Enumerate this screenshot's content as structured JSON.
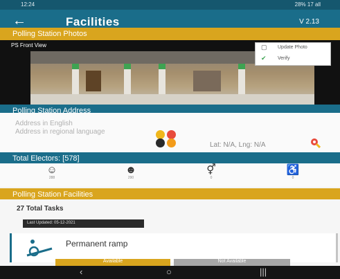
{
  "status_bar": {
    "time": "12:24",
    "right": "28% 17 all"
  },
  "app_bar": {
    "title": "Facilities",
    "version": "V 2.13"
  },
  "photos_section": {
    "title": "Polling Station Photos",
    "photo_label": "PS Front View",
    "update_photo": "Update Photo",
    "verify": "Verify"
  },
  "address_section": {
    "title": "Polling Station Address",
    "english": "Address in English",
    "regional": "Address in regional language",
    "latlng": "Lat: N/A, Lng: N/A"
  },
  "electors": {
    "title": "Total Electors: [578]",
    "icons": [
      {
        "icon": "voter-male-icon",
        "sub": "288"
      },
      {
        "icon": "voter-female-icon",
        "sub": "290"
      },
      {
        "icon": "third-gender-icon",
        "sub": "0"
      },
      {
        "icon": "wheelchair-icon",
        "sub": "0"
      }
    ]
  },
  "facilities": {
    "title": "Polling Station Facilities",
    "total_tasks": "27 Total Tasks",
    "last_updated": "Last Updated: 05-12-2021",
    "items": [
      {
        "label": "Permanent ramp",
        "available": "Available",
        "not_available": "Not Available"
      }
    ]
  },
  "colors": {
    "primary": "#1a6d8a",
    "accent": "#d9a51e",
    "status_bar": "#15576e"
  }
}
